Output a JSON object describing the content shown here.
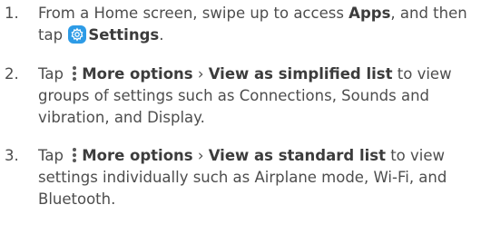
{
  "steps": [
    {
      "number": "1.",
      "t1": "From a Home screen, swipe up to access ",
      "b1": "Apps",
      "t2": ", and then tap ",
      "icon": "settings-gear-icon",
      "b2": "Settings",
      "t3": "."
    },
    {
      "number": "2.",
      "t1": "Tap ",
      "icon": "more-options-icon",
      "b1": "More options",
      "sep": " › ",
      "b2": "View as simplified list",
      "t2": " to view groups of settings such as Connections, Sounds and vibration, and Display."
    },
    {
      "number": "3.",
      "t1": "Tap ",
      "icon": "more-options-icon",
      "b1": "More options",
      "sep": " › ",
      "b2": "View as standard list",
      "t2": " to view settings individually such as Airplane mode, Wi-Fi, and Bluetooth."
    }
  ],
  "colors": {
    "text": "#4d4d4d",
    "settings_icon_bg": "#2d9be6"
  }
}
